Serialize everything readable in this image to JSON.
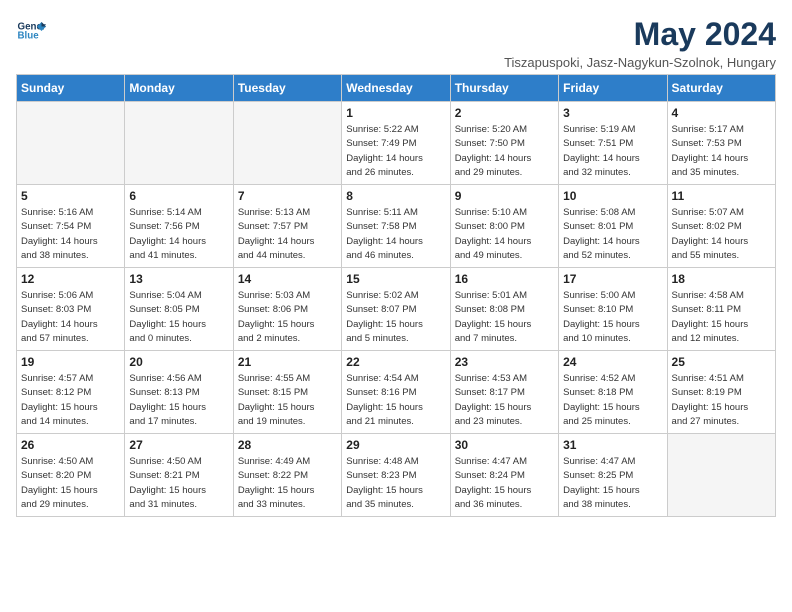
{
  "logo": {
    "line1": "General",
    "line2": "Blue"
  },
  "title": "May 2024",
  "subtitle": "Tiszapuspoki, Jasz-Nagykun-Szolnok, Hungary",
  "weekdays": [
    "Sunday",
    "Monday",
    "Tuesday",
    "Wednesday",
    "Thursday",
    "Friday",
    "Saturday"
  ],
  "weeks": [
    [
      {
        "day": "",
        "info": ""
      },
      {
        "day": "",
        "info": ""
      },
      {
        "day": "",
        "info": ""
      },
      {
        "day": "1",
        "info": "Sunrise: 5:22 AM\nSunset: 7:49 PM\nDaylight: 14 hours\nand 26 minutes."
      },
      {
        "day": "2",
        "info": "Sunrise: 5:20 AM\nSunset: 7:50 PM\nDaylight: 14 hours\nand 29 minutes."
      },
      {
        "day": "3",
        "info": "Sunrise: 5:19 AM\nSunset: 7:51 PM\nDaylight: 14 hours\nand 32 minutes."
      },
      {
        "day": "4",
        "info": "Sunrise: 5:17 AM\nSunset: 7:53 PM\nDaylight: 14 hours\nand 35 minutes."
      }
    ],
    [
      {
        "day": "5",
        "info": "Sunrise: 5:16 AM\nSunset: 7:54 PM\nDaylight: 14 hours\nand 38 minutes."
      },
      {
        "day": "6",
        "info": "Sunrise: 5:14 AM\nSunset: 7:56 PM\nDaylight: 14 hours\nand 41 minutes."
      },
      {
        "day": "7",
        "info": "Sunrise: 5:13 AM\nSunset: 7:57 PM\nDaylight: 14 hours\nand 44 minutes."
      },
      {
        "day": "8",
        "info": "Sunrise: 5:11 AM\nSunset: 7:58 PM\nDaylight: 14 hours\nand 46 minutes."
      },
      {
        "day": "9",
        "info": "Sunrise: 5:10 AM\nSunset: 8:00 PM\nDaylight: 14 hours\nand 49 minutes."
      },
      {
        "day": "10",
        "info": "Sunrise: 5:08 AM\nSunset: 8:01 PM\nDaylight: 14 hours\nand 52 minutes."
      },
      {
        "day": "11",
        "info": "Sunrise: 5:07 AM\nSunset: 8:02 PM\nDaylight: 14 hours\nand 55 minutes."
      }
    ],
    [
      {
        "day": "12",
        "info": "Sunrise: 5:06 AM\nSunset: 8:03 PM\nDaylight: 14 hours\nand 57 minutes."
      },
      {
        "day": "13",
        "info": "Sunrise: 5:04 AM\nSunset: 8:05 PM\nDaylight: 15 hours\nand 0 minutes."
      },
      {
        "day": "14",
        "info": "Sunrise: 5:03 AM\nSunset: 8:06 PM\nDaylight: 15 hours\nand 2 minutes."
      },
      {
        "day": "15",
        "info": "Sunrise: 5:02 AM\nSunset: 8:07 PM\nDaylight: 15 hours\nand 5 minutes."
      },
      {
        "day": "16",
        "info": "Sunrise: 5:01 AM\nSunset: 8:08 PM\nDaylight: 15 hours\nand 7 minutes."
      },
      {
        "day": "17",
        "info": "Sunrise: 5:00 AM\nSunset: 8:10 PM\nDaylight: 15 hours\nand 10 minutes."
      },
      {
        "day": "18",
        "info": "Sunrise: 4:58 AM\nSunset: 8:11 PM\nDaylight: 15 hours\nand 12 minutes."
      }
    ],
    [
      {
        "day": "19",
        "info": "Sunrise: 4:57 AM\nSunset: 8:12 PM\nDaylight: 15 hours\nand 14 minutes."
      },
      {
        "day": "20",
        "info": "Sunrise: 4:56 AM\nSunset: 8:13 PM\nDaylight: 15 hours\nand 17 minutes."
      },
      {
        "day": "21",
        "info": "Sunrise: 4:55 AM\nSunset: 8:15 PM\nDaylight: 15 hours\nand 19 minutes."
      },
      {
        "day": "22",
        "info": "Sunrise: 4:54 AM\nSunset: 8:16 PM\nDaylight: 15 hours\nand 21 minutes."
      },
      {
        "day": "23",
        "info": "Sunrise: 4:53 AM\nSunset: 8:17 PM\nDaylight: 15 hours\nand 23 minutes."
      },
      {
        "day": "24",
        "info": "Sunrise: 4:52 AM\nSunset: 8:18 PM\nDaylight: 15 hours\nand 25 minutes."
      },
      {
        "day": "25",
        "info": "Sunrise: 4:51 AM\nSunset: 8:19 PM\nDaylight: 15 hours\nand 27 minutes."
      }
    ],
    [
      {
        "day": "26",
        "info": "Sunrise: 4:50 AM\nSunset: 8:20 PM\nDaylight: 15 hours\nand 29 minutes."
      },
      {
        "day": "27",
        "info": "Sunrise: 4:50 AM\nSunset: 8:21 PM\nDaylight: 15 hours\nand 31 minutes."
      },
      {
        "day": "28",
        "info": "Sunrise: 4:49 AM\nSunset: 8:22 PM\nDaylight: 15 hours\nand 33 minutes."
      },
      {
        "day": "29",
        "info": "Sunrise: 4:48 AM\nSunset: 8:23 PM\nDaylight: 15 hours\nand 35 minutes."
      },
      {
        "day": "30",
        "info": "Sunrise: 4:47 AM\nSunset: 8:24 PM\nDaylight: 15 hours\nand 36 minutes."
      },
      {
        "day": "31",
        "info": "Sunrise: 4:47 AM\nSunset: 8:25 PM\nDaylight: 15 hours\nand 38 minutes."
      },
      {
        "day": "",
        "info": ""
      }
    ]
  ]
}
